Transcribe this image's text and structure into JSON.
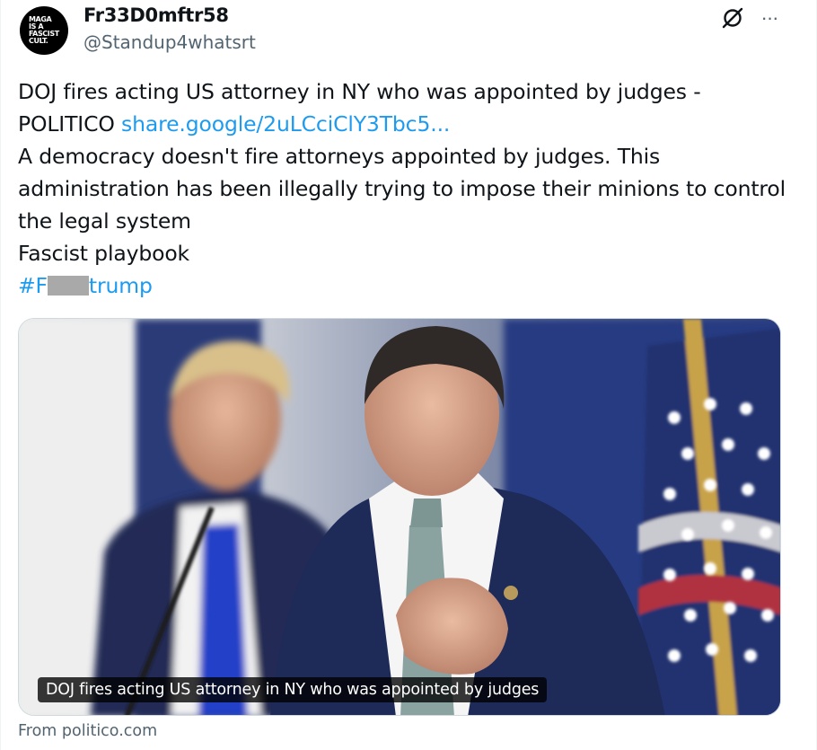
{
  "author": {
    "display_name": "Fr33D0mftr58",
    "handle": "@Standup4whatsrt",
    "avatar_text": [
      "MAGA",
      "IS A",
      "FASCIST",
      "CULT."
    ]
  },
  "header_icons": {
    "grok": "grok-icon",
    "more": "more-icon",
    "more_glyph": "···"
  },
  "post": {
    "line1": "DOJ fires acting US attorney in NY who was appointed by judges -",
    "line2_text": "POLITICO ",
    "line2_link": "share.google/2uLCciClY3Tbc5...",
    "line3": "A democracy doesn't fire attorneys appointed by judges. This",
    "line4": "administration has been illegally trying to impose their minions to control",
    "line5": "the legal system",
    "line6": "Fascist playbook",
    "hashtag_start": "#F",
    "hashtag_end": "trump"
  },
  "card": {
    "caption": "DOJ fires acting US attorney in NY who was appointed by judges",
    "source": "From politico.com"
  },
  "colors": {
    "link": "#1d9bf0",
    "secondary_text": "#536471",
    "primary_text": "#0f1419"
  }
}
